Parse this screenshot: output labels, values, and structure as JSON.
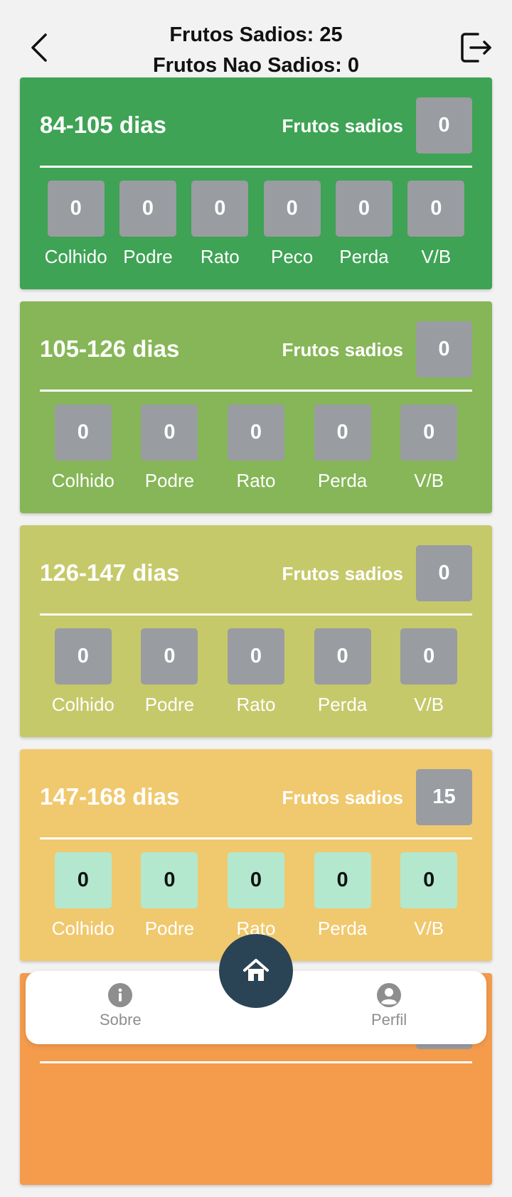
{
  "header": {
    "line1": "Frutos Sadios: 25",
    "line2": "Frutos Nao Sadios: 0",
    "back_icon": "chevron-left-icon",
    "logout_icon": "logout-icon"
  },
  "colors": {
    "card1": "#3ea354",
    "card2": "#86b657",
    "card3": "#c5c96a",
    "card4": "#f0c96e",
    "card5": "#f49b4c",
    "stat_box": "#999ca1",
    "stat_box_active": "#b3e8cf",
    "home_button": "#2b4455"
  },
  "cards": [
    {
      "range": "84-105 dias",
      "fs_label": "Frutos sadios",
      "fs_value": "0",
      "stats": [
        {
          "value": "0",
          "label": "Colhido"
        },
        {
          "value": "0",
          "label": "Podre"
        },
        {
          "value": "0",
          "label": "Rato"
        },
        {
          "value": "0",
          "label": "Peco"
        },
        {
          "value": "0",
          "label": "Perda"
        },
        {
          "value": "0",
          "label": "V/B"
        }
      ]
    },
    {
      "range": "105-126 dias",
      "fs_label": "Frutos sadios",
      "fs_value": "0",
      "stats": [
        {
          "value": "0",
          "label": "Colhido"
        },
        {
          "value": "0",
          "label": "Podre"
        },
        {
          "value": "0",
          "label": "Rato"
        },
        {
          "value": "0",
          "label": "Perda"
        },
        {
          "value": "0",
          "label": "V/B"
        }
      ]
    },
    {
      "range": "126-147 dias",
      "fs_label": "Frutos sadios",
      "fs_value": "0",
      "stats": [
        {
          "value": "0",
          "label": "Colhido"
        },
        {
          "value": "0",
          "label": "Podre"
        },
        {
          "value": "0",
          "label": "Rato"
        },
        {
          "value": "0",
          "label": "Perda"
        },
        {
          "value": "0",
          "label": "V/B"
        }
      ]
    },
    {
      "range": "147-168 dias",
      "fs_label": "Frutos sadios",
      "fs_value": "15",
      "stats": [
        {
          "value": "0",
          "label": "Colhido"
        },
        {
          "value": "0",
          "label": "Podre"
        },
        {
          "value": "0",
          "label": "Rato"
        },
        {
          "value": "0",
          "label": "Perda"
        },
        {
          "value": "0",
          "label": "V/B"
        }
      ]
    }
  ],
  "bottom_nav": {
    "sobre": {
      "label": "Sobre",
      "icon": "info-icon"
    },
    "home": {
      "icon": "home-icon"
    },
    "perfil": {
      "label": "Perfil",
      "icon": "user-icon"
    }
  }
}
